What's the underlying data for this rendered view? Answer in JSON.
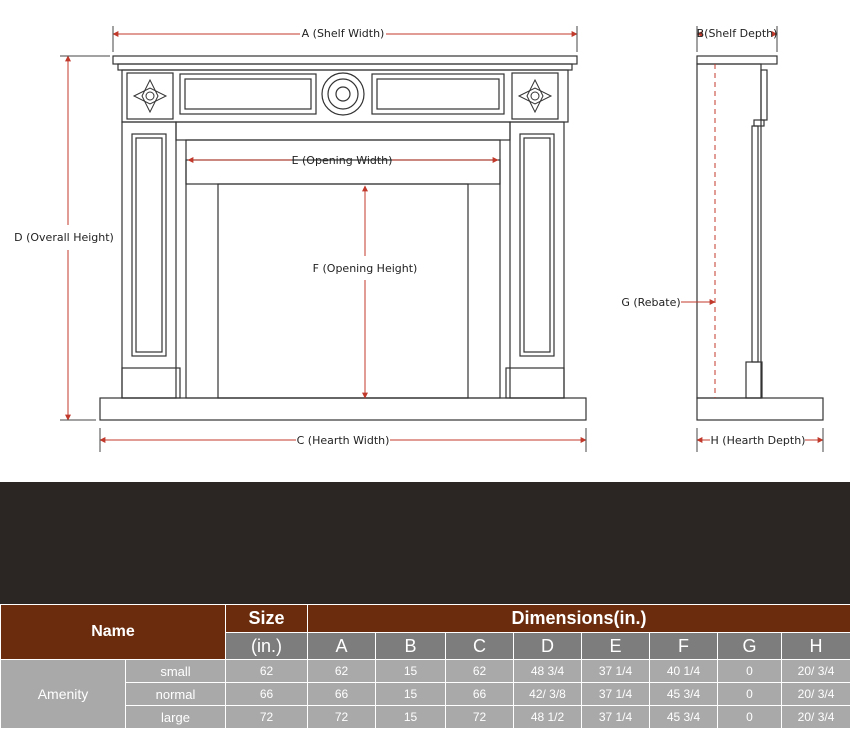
{
  "labels": {
    "a": "A (Shelf Width)",
    "b": "B(Shelf Depth)",
    "c": "C (Hearth Width)",
    "d": "D (Overall Height)",
    "e": "E (Opening Width)",
    "f": "F (Opening Height)",
    "g": "G (Rebate)",
    "h": "H (Hearth Depth)"
  },
  "table": {
    "name_header": "Name",
    "size_header": "Size",
    "dimensions_header": "Dimensions(in.)",
    "sub_headers": [
      "(in.)",
      "A",
      "B",
      "C",
      "D",
      "E",
      "F",
      "G",
      "H"
    ],
    "model_name": "Amenity",
    "rows": [
      {
        "size": "small",
        "values": [
          "62",
          "62",
          "15",
          "62",
          "48 3/4",
          "37 1/4",
          "40 1/4",
          "0",
          "20/ 3/4"
        ]
      },
      {
        "size": "normal",
        "values": [
          "66",
          "66",
          "15",
          "66",
          "42/ 3/8",
          "37 1/4",
          "45 3/4",
          "0",
          "20/ 3/4"
        ]
      },
      {
        "size": "large",
        "values": [
          "72",
          "72",
          "15",
          "72",
          "48 1/2",
          "37 1/4",
          "45 3/4",
          "0",
          "20/ 3/4"
        ]
      }
    ]
  },
  "colors": {
    "header_brown": "#6a2c0c",
    "subheader_gray": "#7d7d7d",
    "body_gray": "#a9a9a9",
    "band_dark": "#2b2624",
    "dimension_red": "#c0392b"
  }
}
